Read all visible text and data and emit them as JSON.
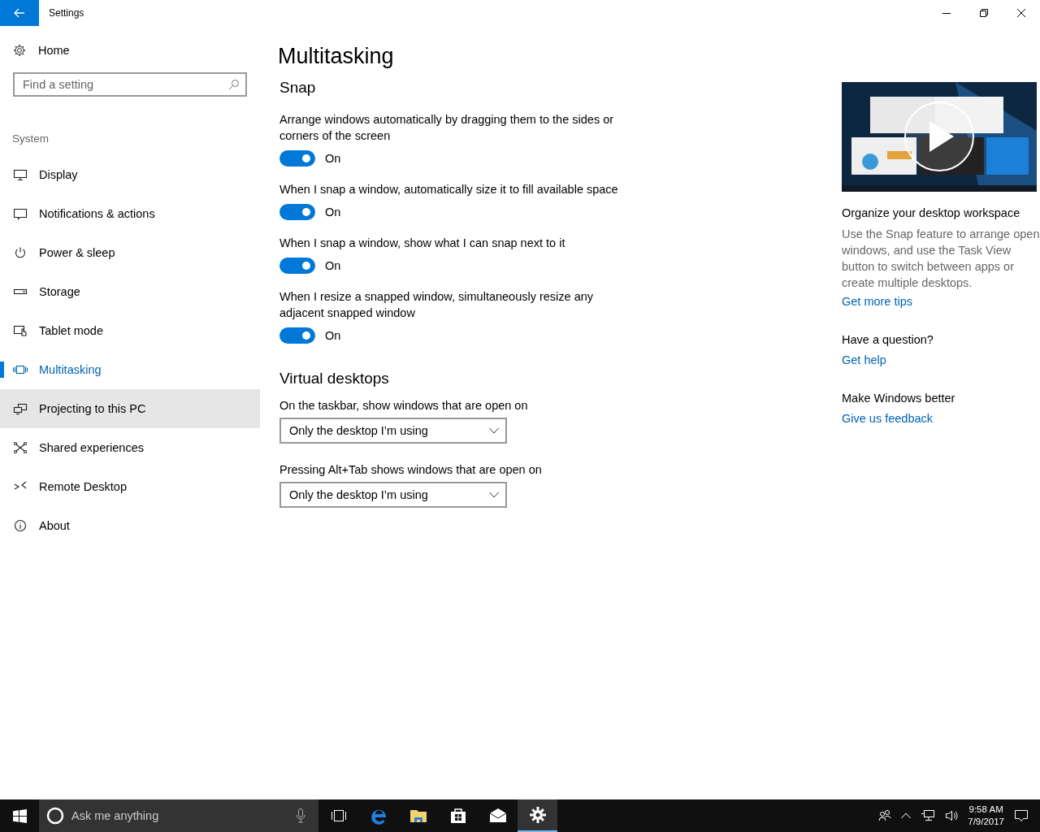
{
  "window": {
    "title": "Settings"
  },
  "sidebar": {
    "home": "Home",
    "search": {
      "placeholder": "Find a setting"
    },
    "section": "System",
    "items": [
      {
        "label": "Display",
        "selected": false,
        "hovered": false
      },
      {
        "label": "Notifications & actions",
        "selected": false,
        "hovered": false
      },
      {
        "label": "Power & sleep",
        "selected": false,
        "hovered": false
      },
      {
        "label": "Storage",
        "selected": false,
        "hovered": false
      },
      {
        "label": "Tablet mode",
        "selected": false,
        "hovered": false
      },
      {
        "label": "Multitasking",
        "selected": true,
        "hovered": false
      },
      {
        "label": "Projecting to this PC",
        "selected": false,
        "hovered": true
      },
      {
        "label": "Shared experiences",
        "selected": false,
        "hovered": false
      },
      {
        "label": "Remote Desktop",
        "selected": false,
        "hovered": false
      },
      {
        "label": "About",
        "selected": false,
        "hovered": false
      }
    ]
  },
  "content": {
    "title": "Multitasking",
    "snap": {
      "heading": "Snap",
      "toggles": [
        {
          "label": "Arrange windows automatically by dragging them to the sides or corners of the screen",
          "on": true,
          "state_text": "On"
        },
        {
          "label": "When I snap a window, automatically size it to fill available space",
          "on": true,
          "state_text": "On"
        },
        {
          "label": "When I snap a window, show what I can snap next to it",
          "on": true,
          "state_text": "On"
        },
        {
          "label": "When I resize a snapped window, simultaneously resize any adjacent snapped window",
          "on": true,
          "state_text": "On"
        }
      ]
    },
    "virtual_desktops": {
      "heading": "Virtual desktops",
      "dropdowns": [
        {
          "label": "On the taskbar, show windows that are open on",
          "value": "Only the desktop I’m using"
        },
        {
          "label": "Pressing Alt+Tab shows windows that are open on",
          "value": "Only the desktop I’m using"
        }
      ]
    }
  },
  "aside": {
    "sections": [
      {
        "heading": "Organize your desktop workspace",
        "text": "Use the Snap feature to arrange open windows, and use the Task View button to switch between apps or create multiple desktops.",
        "link": "Get more tips"
      },
      {
        "heading": "Have a question?",
        "link": "Get help"
      },
      {
        "heading": "Make Windows better",
        "link": "Give us feedback"
      }
    ]
  },
  "taskbar": {
    "search": {
      "placeholder": "Ask me anything"
    },
    "apps": [
      {
        "selected": false
      },
      {
        "selected": false
      },
      {
        "selected": false
      },
      {
        "selected": false
      },
      {
        "selected": false
      },
      {
        "selected": true
      }
    ],
    "clock": {
      "time": "9:58 AM",
      "date": "7/9/2017"
    }
  }
}
